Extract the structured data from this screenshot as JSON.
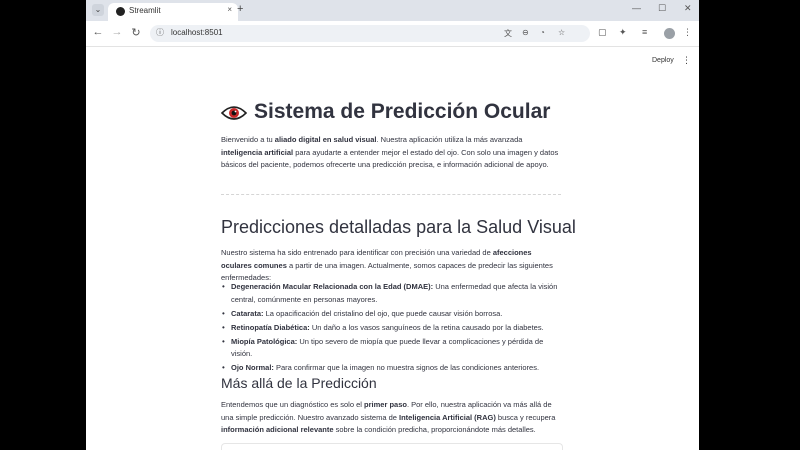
{
  "browser": {
    "tab_title": "Streamlit",
    "url": "localhost:8501",
    "tab_menu_icon": "chevron-down-icon",
    "new_tab_label": "+",
    "close_label": "×",
    "minimize_label": "—",
    "maximize_label": "☐",
    "window_close_label": "✕"
  },
  "app": {
    "deploy_label": "Deploy",
    "menu_label": "⋮"
  },
  "page": {
    "title": "Sistema de Predicción Ocular",
    "intro": {
      "p1": "Bienvenido a tu ",
      "b1": "aliado digital en salud visual",
      "p2": ". Nuestra aplicación utiliza la más avanzada ",
      "b2": "inteligencia artificial",
      "p3": " para ayudarte a entender mejor el estado del ojo. Con solo una imagen y datos básicos del paciente, podemos ofrecerte una predicción precisa, e información adicional de apoyo."
    },
    "section1": {
      "heading": "Predicciones detalladas para la Salud Visual",
      "p1": "Nuestro sistema ha sido entrenado para identificar con precisión una variedad de ",
      "b1": "afecciones oculares comunes",
      "p2": " a partir de una imagen. Actualmente, somos capaces de predecir las siguientes enfermedades:",
      "items": [
        {
          "name": "Degeneración Macular Relacionada con la Edad (DMAE):",
          "desc": " Una enfermedad que afecta la visión central, comúnmente en personas mayores."
        },
        {
          "name": "Catarata:",
          "desc": " La opacificación del cristalino del ojo, que puede causar visión borrosa."
        },
        {
          "name": "Retinopatía Diabética:",
          "desc": " Un daño a los vasos sanguíneos de la retina causado por la diabetes."
        },
        {
          "name": "Miopía Patológica:",
          "desc": " Un tipo severo de miopía que puede llevar a complicaciones y pérdida de visión."
        },
        {
          "name": "Ojo Normal:",
          "desc": " Para confirmar que la imagen no muestra signos de las condiciones anteriores."
        }
      ]
    },
    "section2": {
      "heading": "Más allá de la Predicción",
      "p1": "Entendemos que un diagnóstico es solo el ",
      "b1": "primer paso",
      "p2": ". Por ello, nuestra aplicación va más allá de una simple predicción. Nuestro avanzado sistema de ",
      "b2": "Inteligencia Artificial (RAG)",
      "p3": " busca y recupera ",
      "b3": "información adicional relevante",
      "p4": " sobre la condición predicha, proporcionándote más detalles."
    }
  },
  "colors": {
    "text": "#31333f",
    "chrome_tabstrip": "#dfe3ea",
    "omnibox": "#eef1f5",
    "eye_red": "#c62828"
  }
}
